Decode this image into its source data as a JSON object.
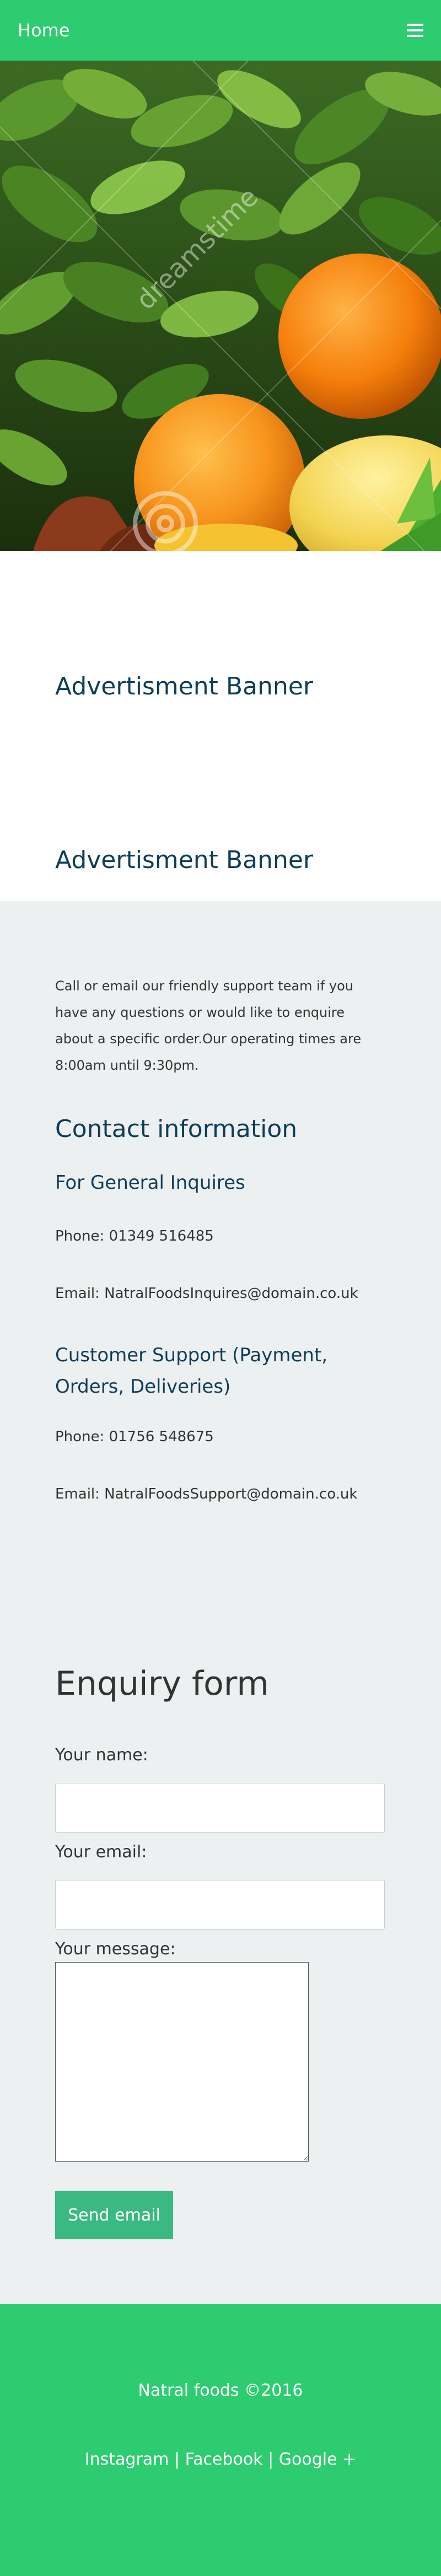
{
  "nav": {
    "home_label": "Home",
    "menu_icon": "hamburger-menu-icon"
  },
  "hero": {
    "image": "fresh-produce-photo",
    "watermark": "dreamstime"
  },
  "ads": {
    "banner_1": "Advertisment Banner",
    "banner_2": "Advertisment Banner"
  },
  "contact": {
    "intro": "Call or email our friendly support team if you have any questions or would like to enquire about a specific order.Our operating times are 8:00am until 9:30pm.",
    "heading": "Contact information",
    "general": {
      "heading": "For General Inquires",
      "phone": "Phone: 01349 516485",
      "email": "Email: NatralFoodsInquires@domain.co.uk"
    },
    "support": {
      "heading": "Customer Support (Payment, Orders, Deliveries)",
      "phone": "Phone: 01756 548675",
      "email": "Email: NatralFoodsSupport@domain.co.uk"
    }
  },
  "enquiry": {
    "heading": "Enquiry form",
    "name_label": "Your name:",
    "name_value": "",
    "email_label": "Your email:",
    "email_value": "",
    "message_label": "Your message:",
    "send_label": "Send email"
  },
  "footer": {
    "copyright": "Natral foods ©2016",
    "links": {
      "instagram": "Instagram",
      "facebook": "Facebook",
      "google": "Google +",
      "separator": "|"
    }
  },
  "colors": {
    "brand_green": "#2ecc71",
    "heading_navy": "#0f3d57",
    "section_gray": "#ecf0f1",
    "button_green": "#3ab981"
  }
}
